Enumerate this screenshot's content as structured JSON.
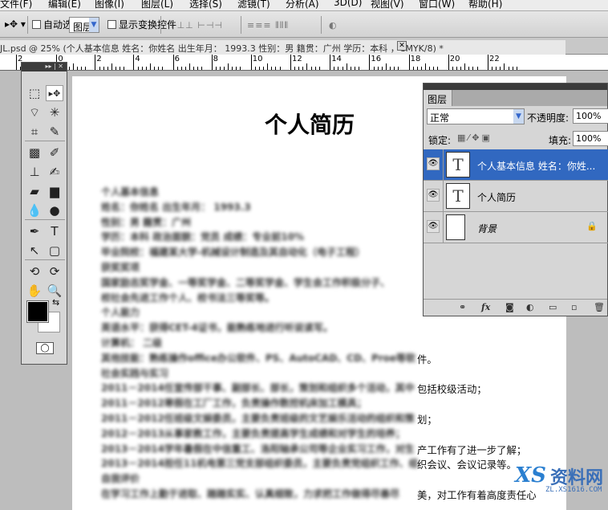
{
  "menu": [
    "文件(F)",
    "编辑(E)",
    "图像(I)",
    "图层(L)",
    "选择(S)",
    "滤镜(T)",
    "分析(A)",
    "3D(D)",
    "视图(V)",
    "窗口(W)",
    "帮助(H)"
  ],
  "options": {
    "tool": "▸✥ ▾",
    "auto_select_label": "自动选择:",
    "auto_select_value": "图层",
    "show_transform_label": "显示变换控件",
    "auto_select_checked": false,
    "show_transform_checked": false
  },
  "document_tab": {
    "title": "JL.psd @ 25% (个人基本信息 姓名：你姓名 出生年月： 1993.3      性别：男    籍贯：广州 学历：本科 ，CMYK/8) *",
    "close": "✕"
  },
  "ruler": [
    "2",
    "0",
    "2",
    "4",
    "6",
    "8",
    "10",
    "12",
    "14",
    "16",
    "18",
    "20",
    "22"
  ],
  "document": {
    "title": "个人简历",
    "lines": [
      {
        "text": "个人基本信息",
        "tail": ""
      },
      {
        "text": "姓名：你姓名  出生年月： 1993.3",
        "tail": ""
      },
      {
        "text": "性别：男    籍贯：广州",
        "tail": ""
      },
      {
        "text": "学历：本科    政治面貌：党员  成绩：专业前10%",
        "tail": ""
      },
      {
        "text": "毕业院校：福建某大学-机械设计制造及其自动化（电子工程）",
        "tail": ""
      },
      {
        "text": "获奖奖项",
        "tail": ""
      },
      {
        "text": "国家励志奖学金、一等奖学金、二等奖学金、学生会工作积极分子、",
        "tail": ""
      },
      {
        "text": "校社会先进工作个人、校书法三等奖等。",
        "tail": ""
      },
      {
        "text": "个人能力",
        "tail": ""
      },
      {
        "text": "英语水平：获得CET-4证书，能熟练地进行听说读写。",
        "tail": ""
      },
      {
        "text": "计算机：  二级",
        "tail": ""
      },
      {
        "text": "其他技能：熟练操作office办公软件、PS、AutoCAD、CD、Proe等软",
        "tail": "件。"
      },
      {
        "text": "社会实践与实习",
        "tail": ""
      },
      {
        "text": "2011－2014任宣传部干事、副部长、部长，策划和组织多个活动，其中",
        "tail": "包括校级活动；"
      },
      {
        "text": "2011－2012寒假在工厂工作，负责操作数控机床加工模具；",
        "tail": ""
      },
      {
        "text": "2011－2012任班级文娱委员，主要负责班级的文艺娱乐活动的组织和策",
        "tail": "划；"
      },
      {
        "text": "2012－2013从事家教工作，主要负责提高学生成绩和对学生的培养；",
        "tail": ""
      },
      {
        "text": "2013－2014学年暑假在中信重工、洛阳轴承公司等企业实习工作，对生",
        "tail": "产工作有了进一步了解；"
      },
      {
        "text": "2013－2014担任11机电第三党支部组织委员，主要负责党组织工作、组",
        "tail": "织会议、会议记录等。"
      },
      {
        "text": "自我评价",
        "tail": ""
      },
      {
        "text": "在学习工作上勤于进取、踏踏实实、认真细致，力求把工作做得尽善尽",
        "tail": "美，对工作有着高度责任心"
      }
    ]
  },
  "layers_panel": {
    "tab": "图层",
    "blend_mode": "正常",
    "opacity_label": "不透明度:",
    "opacity": "100%",
    "lock_label": "锁定:",
    "fill_label": "填充:",
    "fill": "100%",
    "layers": [
      {
        "name": "个人基本信息 姓名：你姓...",
        "thumb": "T",
        "selected": true
      },
      {
        "name": "个人简历",
        "thumb": "T",
        "selected": false
      },
      {
        "name": "背景",
        "thumb": "",
        "selected": false,
        "locked": true
      }
    ],
    "footer_icons": [
      "link-icon",
      "fx-icon",
      "mask-icon",
      "adjustment-icon",
      "folder-icon",
      "new-layer-icon",
      "trash-icon"
    ],
    "fx": "fx"
  },
  "colors": {
    "selection": "#3168c0",
    "foreground": "#000000",
    "background": "#ffffff"
  },
  "watermark": {
    "brand": "资料网",
    "url": "ZL.XS1616.COM",
    "logo": "XS"
  }
}
